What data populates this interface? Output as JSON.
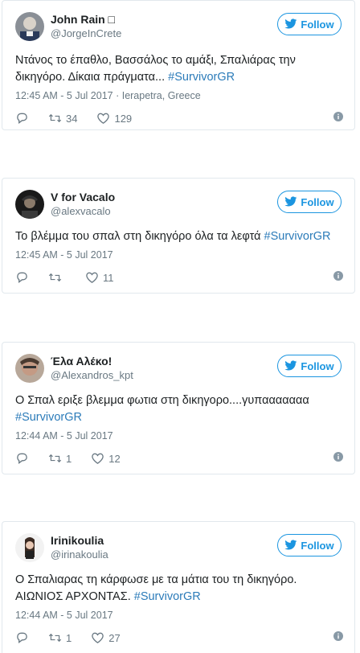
{
  "follow_label": "Follow",
  "tweets": [
    {
      "display_name": "John Rain □",
      "handle": "@JorgeInCrete",
      "text": "Ντάνος το έπαθλο, Βασσάλος το αμάξι, Σπαλιάρας την δικηγόρο. Δίκαια πράγματα... ",
      "hashtag": "#SurvivorGR",
      "time": "12:45 AM - 5 Jul 2017",
      "location": "Ierapetra, Greece",
      "retweets": "34",
      "likes": "129"
    },
    {
      "display_name": "V for Vacalo",
      "handle": "@alexvacalo",
      "text": "Το βλέμμα του σπαλ στη δικηγόρο όλα τα λεφτά ",
      "hashtag": "#SurvivorGR",
      "time": "12:45 AM - 5 Jul 2017",
      "retweets": "",
      "likes": "11"
    },
    {
      "display_name": "Έλα Αλέκο!",
      "handle": "@Alexandros_kpt",
      "text": "Ο Σπαλ εριξε βλεμμα φωτια στη δικηγορο....γυπααααααα ",
      "hashtag": "#SurvivorGR",
      "time": "12:44 AM - 5 Jul 2017",
      "retweets": "1",
      "likes": "12"
    },
    {
      "display_name": "Irinikoulia",
      "handle": "@irinakoulia",
      "text": "Ο Σπαλιαρας τη κάρφωσε με τα μάτια του τη δικηγόρο. ΑΙΩΝΙΟΣ ΑΡΧΟΝΤΑΣ. ",
      "hashtag": "#SurvivorGR",
      "time": "12:44 AM - 5 Jul 2017",
      "retweets": "1",
      "likes": "27"
    }
  ],
  "colors": {
    "accent": "#1b95e0",
    "hashtag": "#2b7bb9",
    "muted": "#697882",
    "border": "#e1e8ed"
  }
}
